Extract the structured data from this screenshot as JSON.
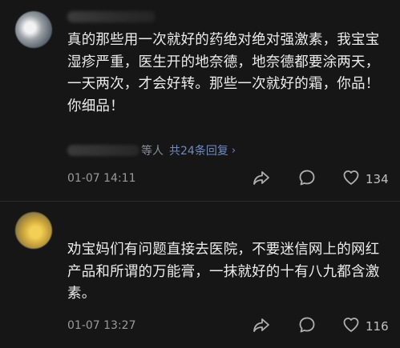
{
  "comments": [
    {
      "text": "真的那些用一次就好的药绝对绝对强激素，我宝宝湿疹严重，医生开的地奈德，地奈德都要涂两天，一天两次，才会好转。那些一次就好的霜，你品！你细品！",
      "reply_suffix": "等人",
      "reply_link": "共24条回复",
      "time": "01-07 14:11",
      "likes": "134"
    },
    {
      "text": "劝宝妈们有问题直接去医院，不要迷信网上的网红产品和所谓的万能膏，一抹就好的十有八九都含激素。",
      "time": "01-07 13:27",
      "likes": "116"
    }
  ],
  "icons": {
    "share": "share-icon",
    "reply": "comment-icon",
    "like": "heart-icon",
    "chevron": "chevron-right-icon"
  },
  "colors": {
    "background": "#161616",
    "text": "#ececec",
    "meta": "#9a9a9a",
    "link": "#6f8ac4"
  }
}
